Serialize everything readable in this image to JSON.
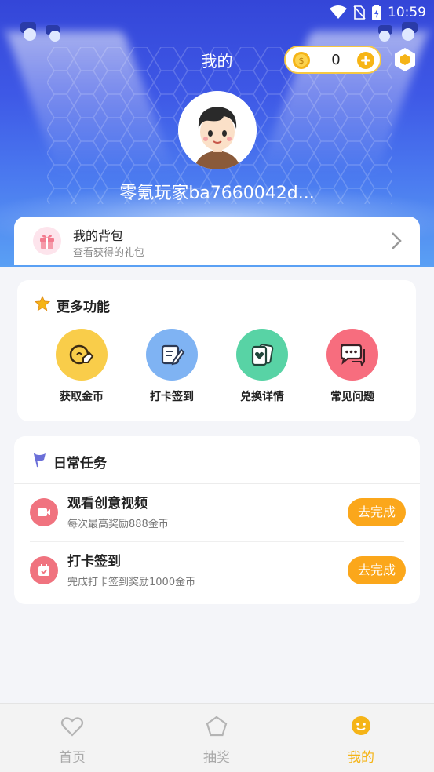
{
  "status_bar": {
    "time": "10:59"
  },
  "header": {
    "title": "我的"
  },
  "coins": {
    "value": "0"
  },
  "user": {
    "name": "零氪玩家ba7660042d..."
  },
  "backpack": {
    "title": "我的背包",
    "subtitle": "查看获得的礼包"
  },
  "more": {
    "title": "更多功能",
    "items": [
      {
        "label": "获取金币",
        "color": "#f9cd4a",
        "icon": "coin-hand-icon"
      },
      {
        "label": "打卡签到",
        "color": "#7fb3f3",
        "icon": "checkin-edit-icon"
      },
      {
        "label": "兑换详情",
        "color": "#58d3a5",
        "icon": "heart-cards-icon"
      },
      {
        "label": "常见问题",
        "color": "#f76d7e",
        "icon": "chat-bubbles-icon"
      }
    ]
  },
  "daily": {
    "title": "日常任务",
    "tasks": [
      {
        "title": "观看创意视频",
        "subtitle": "每次最高奖励888金币",
        "button": "去完成"
      },
      {
        "title": "打卡签到",
        "subtitle": "完成打卡签到奖励1000金币",
        "button": "去完成"
      }
    ]
  },
  "nav": {
    "items": [
      {
        "label": "首页"
      },
      {
        "label": "抽奖"
      },
      {
        "label": "我的"
      }
    ],
    "active_color": "#f5b417"
  }
}
